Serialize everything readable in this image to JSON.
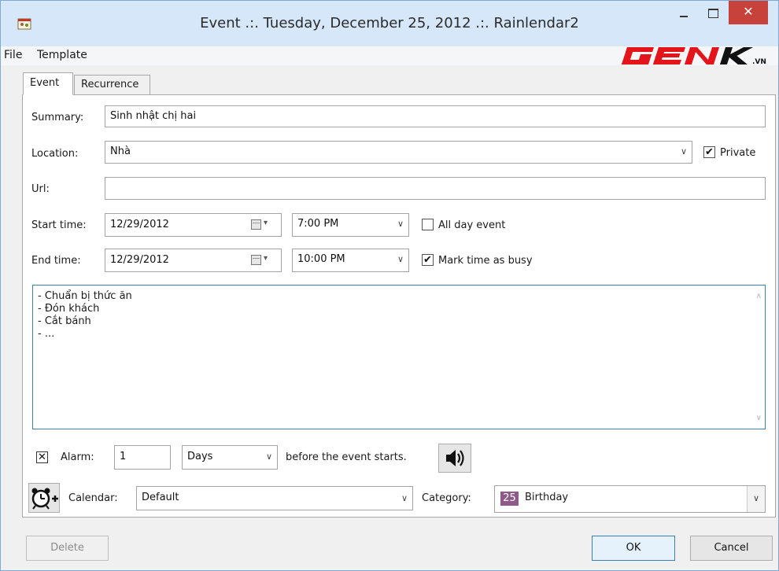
{
  "window": {
    "title": "Event .:. Tuesday, December 25, 2012 .:. Rainlendar2",
    "close_glyph": "✕"
  },
  "menu": {
    "file": "File",
    "template": "Template"
  },
  "logo": {
    "text_main": "GENK",
    "text_suffix": ".VN",
    "color": "#e4141b"
  },
  "tabs": [
    {
      "label": "Event"
    },
    {
      "label": "Recurrence"
    }
  ],
  "form": {
    "summary_label": "Summary:",
    "summary_value": "Sinh nhật chị hai",
    "location_label": "Location:",
    "location_value": "Nhà",
    "private_label": "Private",
    "private_checked": true,
    "url_label": "Url:",
    "url_value": "",
    "start_label": "Start time:",
    "start_date": "12/29/2012",
    "start_time": "7:00 PM",
    "all_day_label": "All day event",
    "all_day_checked": false,
    "end_label": "End time:",
    "end_date": "12/29/2012",
    "end_time": "10:00 PM",
    "busy_label": "Mark time as busy",
    "busy_checked": true,
    "notes": [
      "- Chuẩn bị thức ăn",
      "- Đón khách",
      "- Cắt bánh",
      "- ..."
    ]
  },
  "alarm": {
    "checked_glyph": "✕",
    "label": "Alarm:",
    "value": "1",
    "unit": "Days",
    "suffix": "before the event starts."
  },
  "calendar": {
    "label": "Calendar:",
    "value": "Default",
    "category_label": "Category:",
    "category_number": "25",
    "category_value": "Birthday",
    "category_color": "#8f5a8a"
  },
  "buttons": {
    "delete": "Delete",
    "ok": "OK",
    "cancel": "Cancel"
  },
  "icons": {
    "combo_arrow": "∨",
    "cal_arrow": "▾",
    "scroll_up": "∧",
    "scroll_down": "∨"
  }
}
